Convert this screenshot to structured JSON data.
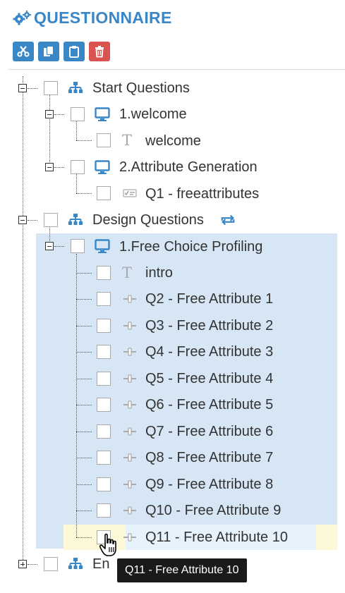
{
  "header": {
    "title": "QUESTIONNAIRE",
    "icon": "gears-icon"
  },
  "toolbar": [
    {
      "name": "cut-button",
      "icon": "scissors-icon",
      "color": "#3a87c8"
    },
    {
      "name": "copy-button",
      "icon": "copy-icon",
      "color": "#3a87c8"
    },
    {
      "name": "paste-button",
      "icon": "clipboard-icon",
      "color": "#3a87c8"
    },
    {
      "name": "delete-button",
      "icon": "trash-icon",
      "color": "#d9534f"
    }
  ],
  "tree": {
    "start_questions": "Start Questions",
    "welcome_group": "1.welcome",
    "welcome_item": "welcome",
    "attr_group": "2.Attribute Generation",
    "q1": "Q1 - freeattributes",
    "design_questions": "Design Questions",
    "profiling_group": "1.Free Choice Profiling",
    "intro": "intro",
    "q2": "Q2 - Free Attribute 1",
    "q3": "Q3 - Free Attribute 2",
    "q4": "Q4 - Free Attribute 3",
    "q5": "Q5 - Free Attribute 4",
    "q6": "Q6 - Free Attribute 5",
    "q7": "Q7 - Free Attribute 6",
    "q8": "Q8 - Free Attribute 7",
    "q9": "Q9 - Free Attribute 8",
    "q10": "Q10 - Free Attribute 9",
    "q11": "Q11 - Free Attribute 10",
    "end_partial": "En"
  },
  "tooltip": {
    "text": "Q11 - Free Attribute 10"
  },
  "colors": {
    "accent": "#3a87c8",
    "danger": "#d9534f",
    "selection": "#d6e6f5",
    "hover": "#fcf8d8"
  }
}
